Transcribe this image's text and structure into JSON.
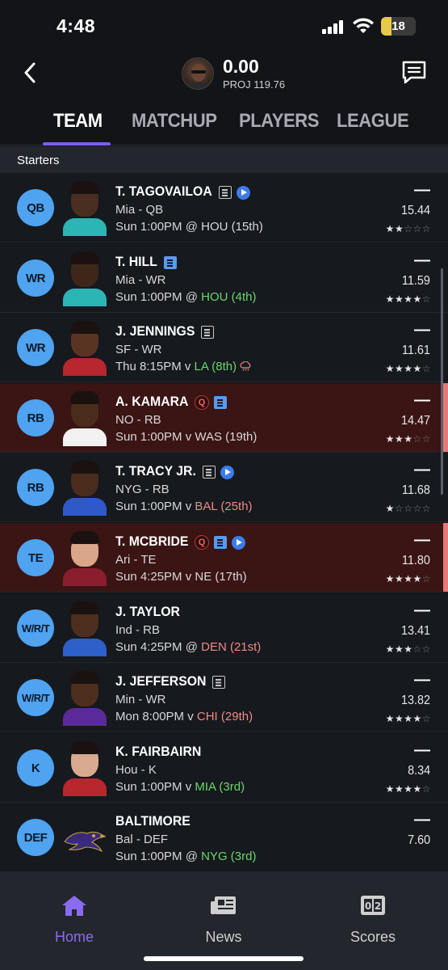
{
  "status_bar": {
    "time": "4:48",
    "battery": "18",
    "battery_level": 0.18
  },
  "header": {
    "score": "0.00",
    "proj": "PROJ 119.76"
  },
  "tabs": [
    {
      "label": "TEAM",
      "active": true
    },
    {
      "label": "MATCHUP",
      "active": false
    },
    {
      "label": "PLAYERS",
      "active": false
    },
    {
      "label": "LEAGUE",
      "active": false
    }
  ],
  "section": {
    "label": "Starters"
  },
  "players": [
    {
      "pos": "QB",
      "name": "T. TAGOVAILOA",
      "team_pos": "Mia - QB",
      "game_prefix": "Sun 1:00PM @ ",
      "opp": "HOU (15th)",
      "opp_class": "neutral",
      "points": "—",
      "proj": "15.44",
      "stars": 2,
      "icons": [
        "news",
        "play"
      ],
      "alert": false,
      "jersey": "#2bb5b5",
      "skin": "#4a2e20"
    },
    {
      "pos": "WR",
      "name": "T. HILL",
      "team_pos": "Mia - WR",
      "game_prefix": "Sun 1:00PM @ ",
      "opp": "HOU (4th)",
      "opp_class": "good",
      "points": "—",
      "proj": "11.59",
      "stars": 4,
      "icons": [
        "news-blue"
      ],
      "alert": false,
      "jersey": "#2bb5b5",
      "skin": "#3e2619"
    },
    {
      "pos": "WR",
      "name": "J. JENNINGS",
      "team_pos": "SF - WR",
      "game_prefix": "Thu 8:15PM v ",
      "opp": "LA (8th)",
      "opp_class": "good",
      "points": "—",
      "proj": "11.61",
      "stars": 4,
      "icons": [
        "news"
      ],
      "alert": false,
      "jersey": "#b8262e",
      "skin": "#5a3422",
      "weather": true
    },
    {
      "pos": "RB",
      "name": "A. KAMARA",
      "team_pos": "NO - RB",
      "game_prefix": "Sun 1:00PM v ",
      "opp": "WAS (19th)",
      "opp_class": "neutral",
      "points": "—",
      "proj": "14.47",
      "stars": 3,
      "icons": [
        "q",
        "news-blue"
      ],
      "alert": true,
      "jersey": "#f2f2f2",
      "skin": "#4a2c1c"
    },
    {
      "pos": "RB",
      "name": "T. TRACY JR.",
      "team_pos": "NYG - RB",
      "game_prefix": "Sun 1:00PM v ",
      "opp": "BAL (25th)",
      "opp_class": "bad",
      "points": "—",
      "proj": "11.68",
      "stars": 1,
      "icons": [
        "news",
        "play"
      ],
      "alert": false,
      "jersey": "#2f58c8",
      "skin": "#4a2c1c"
    },
    {
      "pos": "TE",
      "name": "T. MCBRIDE",
      "team_pos": "Ari - TE",
      "game_prefix": "Sun 4:25PM v ",
      "opp": "NE (17th)",
      "opp_class": "neutral",
      "points": "—",
      "proj": "11.80",
      "stars": 4,
      "icons": [
        "q",
        "news-blue",
        "play"
      ],
      "alert": true,
      "jersey": "#8a1e2e",
      "skin": "#d9a68a"
    },
    {
      "pos": "W/R/T",
      "name": "J. TAYLOR",
      "team_pos": "Ind - RB",
      "game_prefix": "Sun 4:25PM @ ",
      "opp": "DEN (21st)",
      "opp_class": "bad",
      "points": "—",
      "proj": "13.41",
      "stars": 3,
      "icons": [],
      "alert": false,
      "jersey": "#2f5fc8",
      "skin": "#4e2e1e"
    },
    {
      "pos": "W/R/T",
      "name": "J. JEFFERSON",
      "team_pos": "Min - WR",
      "game_prefix": "Mon 8:00PM v ",
      "opp": "CHI (29th)",
      "opp_class": "bad",
      "points": "—",
      "proj": "13.82",
      "stars": 4,
      "icons": [
        "news"
      ],
      "alert": false,
      "jersey": "#5a2a9a",
      "skin": "#4e2e1e"
    },
    {
      "pos": "K",
      "name": "K. FAIRBAIRN",
      "team_pos": "Hou - K",
      "game_prefix": "Sun 1:00PM v ",
      "opp": "MIA (3rd)",
      "opp_class": "good",
      "points": "—",
      "proj": "8.34",
      "stars": 4,
      "icons": [],
      "alert": false,
      "jersey": "#b8262e",
      "skin": "#d9aa90"
    },
    {
      "pos": "DEF",
      "name": "BALTIMORE",
      "team_pos": "Bal - DEF",
      "game_prefix": "Sun 1:00PM @ ",
      "opp": "NYG (3rd)",
      "opp_class": "good",
      "points": "—",
      "proj": "7.60",
      "stars": 0,
      "icons": [],
      "alert": false,
      "logo": true
    }
  ],
  "bottom_nav": [
    {
      "label": "Home",
      "icon": "home-icon",
      "active": true
    },
    {
      "label": "News",
      "icon": "newspaper-icon",
      "active": false
    },
    {
      "label": "Scores",
      "icon": "scoreboard-icon",
      "active": false
    }
  ],
  "colors": {
    "accent": "#7a5ff0",
    "badge": "#4fa3f0",
    "alert_row": "#3b1414",
    "good": "#6ad86a",
    "bad": "#f08a84"
  }
}
